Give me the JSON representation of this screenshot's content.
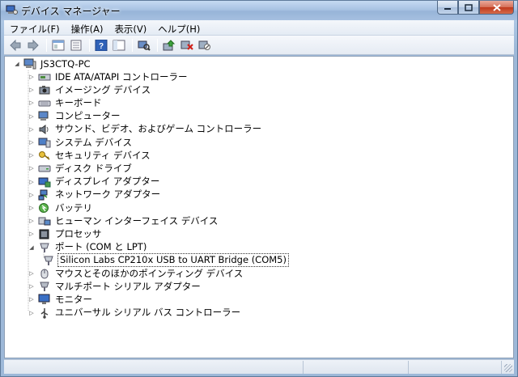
{
  "window": {
    "title": "デバイス マネージャー"
  },
  "menu": [
    "ファイル(F)",
    "操作(A)",
    "表示(V)",
    "ヘルプ(H)"
  ],
  "toolbar_icons": [
    "back-icon",
    "forward-icon",
    "sep",
    "properties-view-icon",
    "list-view-icon",
    "sep",
    "help-icon",
    "tree-view-icon",
    "sep",
    "scan-hardware-icon",
    "sep",
    "update-driver-icon",
    "uninstall-icon",
    "disable-icon"
  ],
  "tree": {
    "root": "JS3CTQ-PC",
    "nodes": [
      {
        "label": "IDE ATA/ATAPI コントローラー",
        "icon": "ide-icon"
      },
      {
        "label": "イメージング デバイス",
        "icon": "camera-icon"
      },
      {
        "label": "キーボード",
        "icon": "keyboard-icon"
      },
      {
        "label": "コンピューター",
        "icon": "computer-icon"
      },
      {
        "label": "サウンド、ビデオ、およびゲーム コントローラー",
        "icon": "speaker-icon"
      },
      {
        "label": "システム デバイス",
        "icon": "system-icon"
      },
      {
        "label": "セキュリティ デバイス",
        "icon": "key-icon"
      },
      {
        "label": "ディスク ドライブ",
        "icon": "disk-icon"
      },
      {
        "label": "ディスプレイ アダプター",
        "icon": "display-icon"
      },
      {
        "label": "ネットワーク アダプター",
        "icon": "network-icon"
      },
      {
        "label": "バッテリ",
        "icon": "battery-icon"
      },
      {
        "label": "ヒューマン インターフェイス デバイス",
        "icon": "hid-icon"
      },
      {
        "label": "プロセッサ",
        "icon": "processor-icon"
      },
      {
        "label": "ポート (COM と LPT)",
        "icon": "port-icon",
        "expanded": true
      },
      {
        "label": "Silicon Labs CP210x USB to UART Bridge (COM5)",
        "icon": "port-device-icon",
        "child": true,
        "selected": true
      },
      {
        "label": "マウスとそのほかのポインティング デバイス",
        "icon": "mouse-icon"
      },
      {
        "label": "マルチポート シリアル アダプター",
        "icon": "multiport-icon"
      },
      {
        "label": "モニター",
        "icon": "monitor-icon"
      },
      {
        "label": "ユニバーサル シリアル バス コントローラー",
        "icon": "usb-icon"
      }
    ]
  }
}
